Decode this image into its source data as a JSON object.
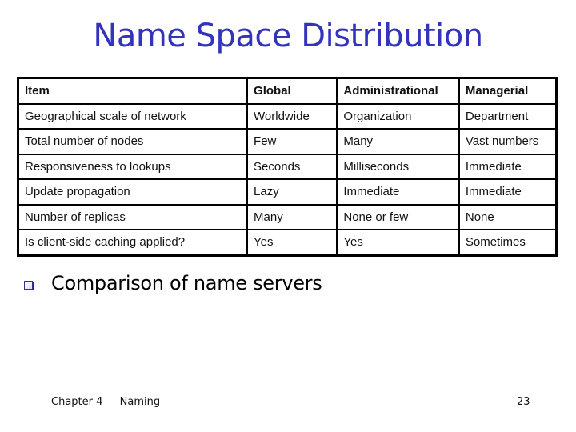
{
  "slide": {
    "title": "Name Space Distribution",
    "table": {
      "headers": [
        "Item",
        "Global",
        "Administrational",
        "Managerial"
      ],
      "rows": [
        [
          "Geographical scale of network",
          "Worldwide",
          "Organization",
          "Department"
        ],
        [
          "Total number of nodes",
          "Few",
          "Many",
          "Vast numbers"
        ],
        [
          "Responsiveness to lookups",
          "Seconds",
          "Milliseconds",
          "Immediate"
        ],
        [
          "Update propagation",
          "Lazy",
          "Immediate",
          "Immediate"
        ],
        [
          "Number of replicas",
          "Many",
          "None or few",
          "None"
        ],
        [
          "Is client-side caching applied?",
          "Yes",
          "Yes",
          "Sometimes"
        ]
      ]
    },
    "bullets": [
      {
        "icon": "square-bullet-icon",
        "text": "Comparison of name servers"
      }
    ],
    "footer": {
      "chapter": "Chapter 4 — Naming",
      "page_number": "23"
    },
    "colors": {
      "title": "#3333bb",
      "bullet": "#333399"
    }
  }
}
